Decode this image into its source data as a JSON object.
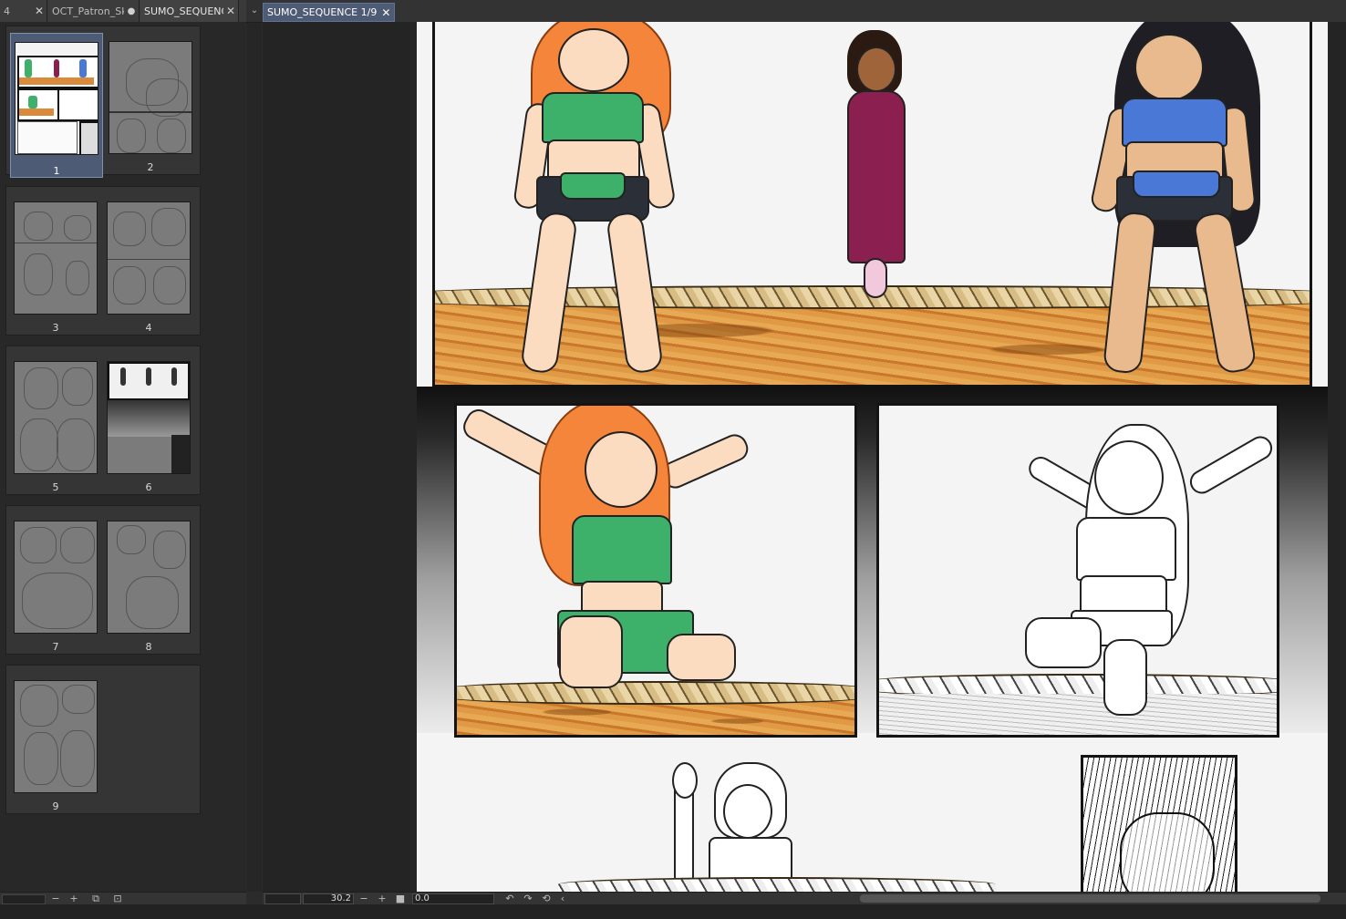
{
  "left_tabs": [
    {
      "label": "4",
      "closable": true
    },
    {
      "label": "OCT_Patron_Sk",
      "modified": true
    },
    {
      "label": "SUMO_SEQUENCE",
      "closable": true
    }
  ],
  "canvas_tab": {
    "label": "SUMO_SEQUENCE 1/9"
  },
  "pages": [
    "1",
    "2",
    "3",
    "4",
    "5",
    "6",
    "7",
    "8",
    "9"
  ],
  "selected_page": "1",
  "bottom_bar": {
    "zoom": "30.2",
    "angle": "0.0"
  },
  "icons": {
    "close": "close-icon",
    "modified": "modified-dot-icon",
    "dropdown": "chevron-down-icon",
    "zoom_out": "minus-icon",
    "zoom_in": "plus-icon",
    "fit": "fit-icon",
    "rotate_left": "rotate-left-icon",
    "rotate_right": "rotate-right-icon",
    "reset_rotation": "reset-rotation-icon",
    "flip": "flip-icon"
  },
  "colors": {
    "selection": "#4d5b74",
    "hair_orange": "#f4853a",
    "top_green": "#3db06a",
    "top_blue": "#4a78d6",
    "kimono": "#8b1f4f",
    "dirt": "#d98b3b"
  }
}
